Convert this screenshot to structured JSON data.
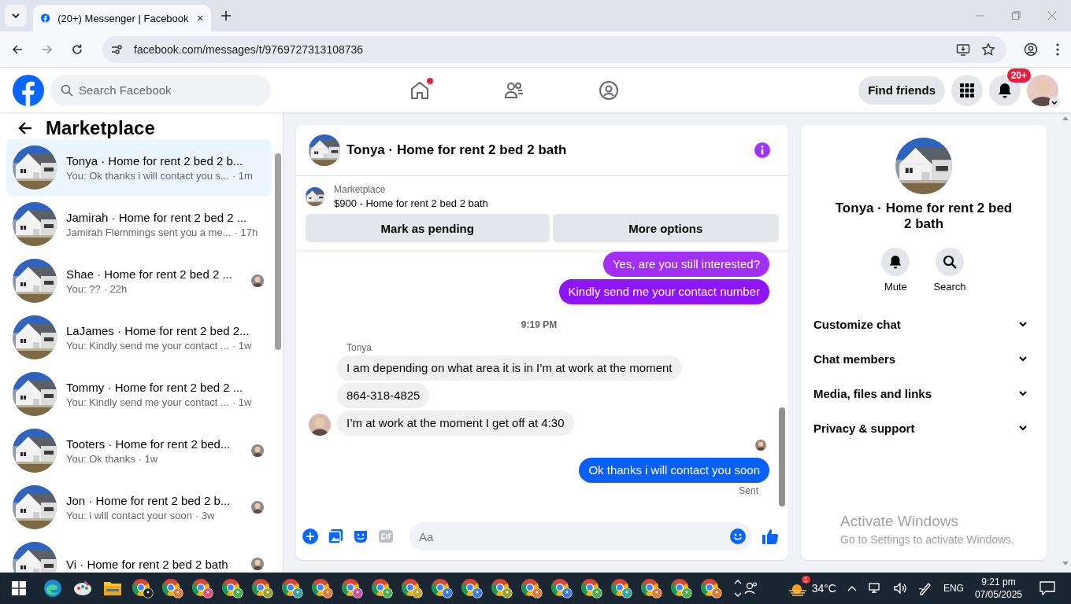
{
  "browser": {
    "tab_title": "(20+) Messenger | Facebook",
    "url": "facebook.com/messages/t/9769727313108736"
  },
  "header": {
    "search_placeholder": "Search Facebook",
    "home_unread": true,
    "find_friends": "Find friends",
    "notification_count": "20+"
  },
  "sidebar": {
    "title": "Marketplace",
    "conversations": [
      {
        "title": "Tonya · Home for rent 2 bed 2 b...",
        "preview": "You: Ok thanks i will contact you s...",
        "time": "· 1m",
        "selected": true,
        "read_receipt": false
      },
      {
        "title": "Jamirah · Home for rent 2 bed 2 ...",
        "preview": "Jamirah Flemmings sent you a me...",
        "time": "· 17h",
        "selected": false,
        "read_receipt": false
      },
      {
        "title": "Shae · Home for rent 2 bed 2 ...",
        "preview": "You: ??",
        "time": "· 22h",
        "selected": false,
        "read_receipt": true
      },
      {
        "title": "LaJames · Home for rent 2 bed 2...",
        "preview": "You: Kindly send me your contact ...",
        "time": "· 1w",
        "selected": false,
        "read_receipt": false
      },
      {
        "title": "Tommy · Home for rent 2 bed 2 ...",
        "preview": "You: Kindly send me your contact ...",
        "time": "· 1w",
        "selected": false,
        "read_receipt": false
      },
      {
        "title": "Tooters · Home for rent 2 bed...",
        "preview": "You: Ok thanks",
        "time": "· 1w",
        "selected": false,
        "read_receipt": true
      },
      {
        "title": "Jon · Home for rent 2 bed 2 b...",
        "preview": "You: i will contact your soon",
        "time": "· 3w",
        "selected": false,
        "read_receipt": true
      },
      {
        "title": "Vi · Home for rent 2 bed 2 bath",
        "selected": false,
        "read_receipt": true
      }
    ]
  },
  "chat": {
    "title": "Tonya · Home for rent 2 bed 2 bath",
    "listing": {
      "source": "Marketplace",
      "title": "$900 - Home for rent 2 bed 2 bath"
    },
    "actions": [
      "Mark as pending",
      "More options"
    ],
    "messages": [
      {
        "kind": "outgoing",
        "text": "Yes, are you still interested?",
        "color": "#a12ff5"
      },
      {
        "kind": "outgoing",
        "text": "Kindly send me your contact number",
        "color": "#8f14f7"
      },
      {
        "kind": "timestamp",
        "text": "9:19 PM"
      },
      {
        "kind": "sender",
        "text": "Tonya"
      },
      {
        "kind": "incoming",
        "text": "I am depending on what area it is in I’m at work at the moment",
        "avatar": false
      },
      {
        "kind": "incoming",
        "text": "864-318-4825",
        "avatar": false
      },
      {
        "kind": "incoming",
        "text": "I’m at work at the moment I get off at 4:30",
        "avatar": true
      },
      {
        "kind": "receipt"
      },
      {
        "kind": "outgoing",
        "text": "Ok thanks i will contact you soon",
        "color": "#0a5ff5"
      },
      {
        "kind": "status",
        "text": "Sent"
      }
    ],
    "composer": {
      "placeholder": "Aa"
    }
  },
  "details": {
    "title": "Tonya · Home for rent 2 bed 2 bath",
    "actions": [
      {
        "kind": "bell",
        "label": "Mute"
      },
      {
        "kind": "search",
        "label": "Search"
      }
    ],
    "sections": [
      {
        "label": "Customize chat",
        "expanded": false
      },
      {
        "label": "Chat members",
        "expanded": false
      },
      {
        "label": "Media, files and links",
        "expanded": false
      },
      {
        "label": "Privacy & support",
        "expanded": false
      }
    ]
  },
  "activation_notice": {
    "title": "Activate Windows",
    "text": "Go to Settings to activate Windows."
  },
  "taskbar": {
    "apps": [
      {
        "kind": "windows"
      },
      {
        "kind": "edge"
      },
      {
        "kind": "paint"
      },
      {
        "kind": "explorer"
      },
      {
        "kind": "chrome",
        "color": "#222222"
      },
      {
        "kind": "chrome",
        "color": "#e07b39"
      },
      {
        "kind": "chrome",
        "color": "#e0507a"
      },
      {
        "kind": "chrome",
        "color": "#4caf50"
      },
      {
        "kind": "chrome",
        "color": "#9aa33a"
      },
      {
        "kind": "chrome",
        "color": "#3aa0a0"
      },
      {
        "kind": "chrome",
        "color": "#e07b39"
      },
      {
        "kind": "chrome",
        "color": "#d04fb0"
      },
      {
        "kind": "chrome",
        "color": "#4caf50"
      },
      {
        "kind": "chrome",
        "color": "#c8a830"
      },
      {
        "kind": "chrome",
        "color": "#3b7dd8"
      },
      {
        "kind": "chrome",
        "color": "#3b7dd8"
      },
      {
        "kind": "chrome",
        "color": "#9aa33a"
      },
      {
        "kind": "chrome",
        "color": "#e07b39"
      },
      {
        "kind": "chrome",
        "color": "#3b7dd8"
      },
      {
        "kind": "chrome",
        "color": "#4caf50"
      },
      {
        "kind": "chrome",
        "color": "#3aa0a0"
      },
      {
        "kind": "chrome",
        "color": "#e07b39"
      },
      {
        "kind": "chrome",
        "color": "#4caf50"
      },
      {
        "kind": "chrome",
        "color": "#e07b39"
      }
    ],
    "weather": {
      "badge": "1",
      "temperature": "34°C"
    },
    "language": "ENG",
    "time": "9:21 pm",
    "date": "07/05/2025"
  }
}
